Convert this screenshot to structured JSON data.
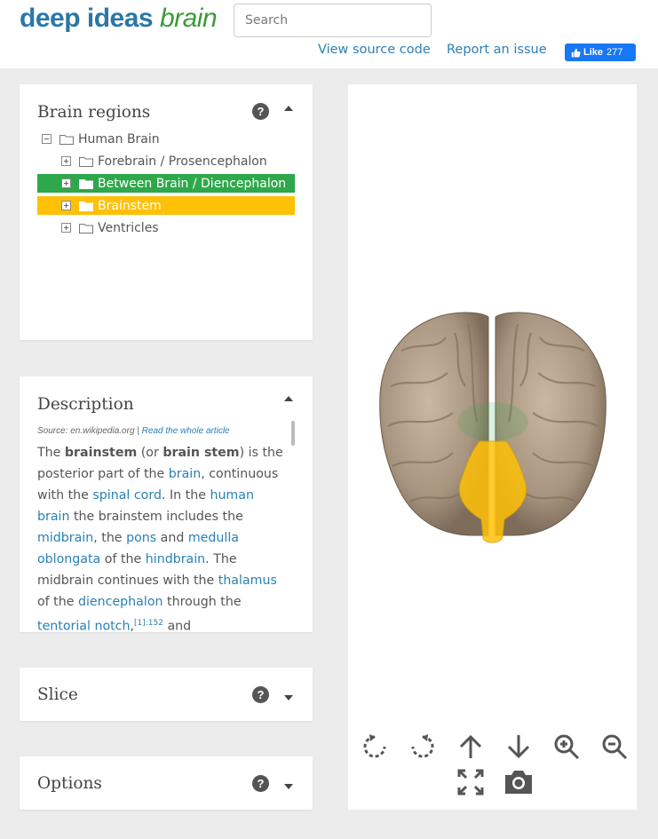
{
  "header": {
    "logo_deep": "deep",
    "logo_ideas": "ideas",
    "logo_brain": "brain",
    "search_placeholder": "Search",
    "view_source": "View source code",
    "report_issue": "Report an issue",
    "fb_like_label": "Like",
    "fb_like_count": "277"
  },
  "brain_regions": {
    "title": "Brain regions",
    "help": "?",
    "tree": [
      {
        "label": "Human Brain",
        "expander": "minus",
        "level": 0,
        "highlight": "none"
      },
      {
        "label": "Forebrain / Prosencephalon",
        "expander": "plus",
        "level": 1,
        "highlight": "none"
      },
      {
        "label": "Between Brain / Diencephalon",
        "expander": "plus",
        "level": 1,
        "highlight": "#2fa84b"
      },
      {
        "label": "Brainstem",
        "expander": "plus",
        "level": 1,
        "highlight": "#ffc107"
      },
      {
        "label": "Ventricles",
        "expander": "plus",
        "level": 1,
        "highlight": "none"
      }
    ]
  },
  "description": {
    "title": "Description",
    "source_prefix": "Source: en.wikipedia.org |",
    "source_link": "Read the whole article",
    "paragraph": {
      "t1": "The ",
      "b1": "brainstem",
      "t2": " (or ",
      "b2": "brain stem",
      "t3": ") is the posterior part of the ",
      "a1": "brain",
      "t4": ", continuous with the ",
      "a2": "spinal cord",
      "t5": ". In the ",
      "a3": "human brain",
      "t6": " the brainstem includes the ",
      "a4": "midbrain",
      "t7": ", the ",
      "a5": "pons",
      "t8": " and ",
      "a6": "medulla oblongata",
      "t9": " of the ",
      "a7": "hindbrain",
      "t10": ". The midbrain continues with the ",
      "a8": "thalamus",
      "t11": " of the ",
      "a9": "diencephalon",
      "t12": " through the ",
      "a10": "tentorial notch",
      "t13": ",",
      "sup": "[1]:152",
      "t14": " and"
    }
  },
  "slice": {
    "title": "Slice",
    "help": "?"
  },
  "options": {
    "title": "Options",
    "help": "?"
  },
  "viewer": {
    "controls": [
      "rotate-left-icon",
      "rotate-right-icon",
      "arrow-up-icon",
      "arrow-down-icon",
      "zoom-in-icon",
      "zoom-out-icon",
      "fullscreen-icon",
      "camera-icon"
    ],
    "highlight_colors": {
      "brainstem": "#ffc107",
      "diencephalon": "#2fa84b"
    }
  },
  "colors": {
    "accent": "#2a80b5",
    "logo_green": "#3a9a3a",
    "facebook": "#1877f2"
  }
}
